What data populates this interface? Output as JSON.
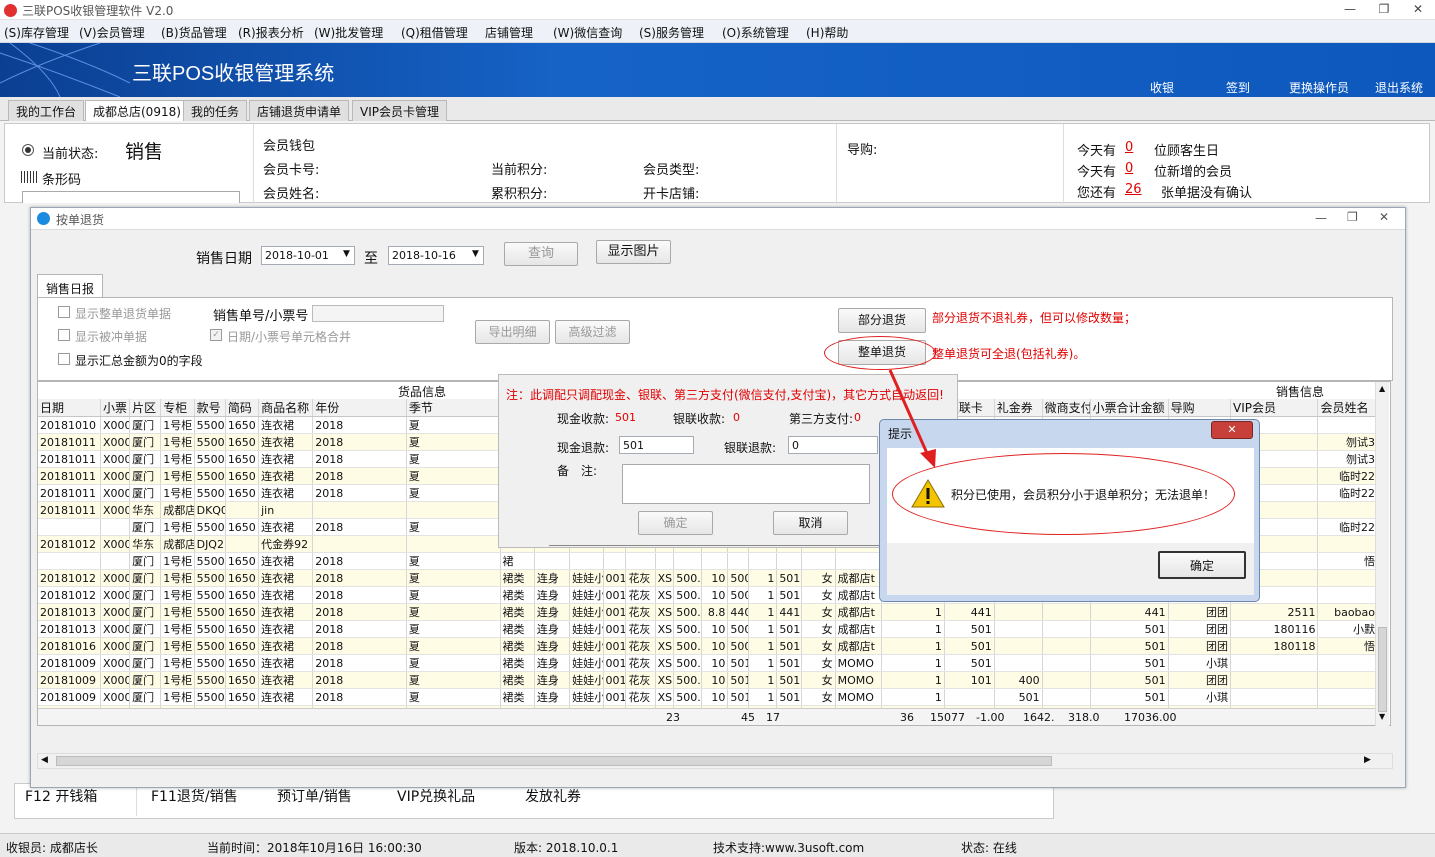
{
  "app": {
    "title": "三联POS收银管理软件 V2.0",
    "brand": "三联POS收银管理系统"
  },
  "window_controls": {
    "minimize": "—",
    "restore": "❐",
    "close": "✕"
  },
  "menu": [
    "(S)库存管理",
    "(V)会员管理",
    "(B)货品管理",
    "(R)报表分析",
    "(W)批发管理",
    "(Q)租借管理",
    "店铺管理",
    "(W)微信查询",
    "(S)服务管理",
    "(O)系统管理",
    "(H)帮助"
  ],
  "banner_links": [
    "收银",
    "签到",
    "更换操作员",
    "退出系统"
  ],
  "tabs": [
    "我的工作台",
    "成都总店(0918)",
    "我的任务",
    "店铺退货申请单",
    "VIP会员卡管理"
  ],
  "status": {
    "label": "当前状态:",
    "value": "销售",
    "barcode": "条形码"
  },
  "member": {
    "wallet": "会员钱包",
    "card_no": "会员卡号:",
    "name": "会员姓名:",
    "points": "当前积分:",
    "acc_points": "累积积分:",
    "type": "会员类型:",
    "store": "开卡店铺:",
    "guide": "导购:"
  },
  "notices": {
    "today1": "今天有",
    "n1": "0",
    "t1": "位顾客生日",
    "today2": "今天有",
    "n2": "0",
    "t2": "位新增的会员",
    "youhave": "您还有",
    "n3": "26",
    "t3": "张单据没有确认"
  },
  "dialog": {
    "title": "按单退货",
    "date_label": "销售日期",
    "date_from": "2018-10-01",
    "date_to_label": "至",
    "date_to": "2018-10-16",
    "query": "查询",
    "show_image": "显示图片",
    "subtab": "销售日报",
    "opt1": "显示整单退货单据",
    "opt2": "显示被冲单据",
    "opt3": "显示汇总金额为0的字段",
    "opt4": "日期/小票号单元格合并",
    "order_label": "销售单号/小票号",
    "export": "导出明细",
    "advanced": "高级过滤",
    "partial": "部分退货",
    "partial_note": "部分退货不退礼券，但可以修改数量；",
    "whole": "整单退货",
    "whole_note": "整单退货可全退(包括礼券)。"
  },
  "grid": {
    "group_left": "货品信息",
    "group_right": "销售信息",
    "headers": [
      "日期",
      "小票",
      "片区",
      "专柜",
      "款号",
      "简码",
      "商品名称",
      "年份",
      "季节",
      "大"
    ],
    "headers_right": [
      "银联卡",
      "礼金券",
      "微商支付",
      "小票合计金额",
      "导购",
      "VIP会员",
      "会员姓名"
    ],
    "rows": [
      [
        "20181010",
        "X000",
        "厦门",
        "1号柜",
        "5500(",
        "1650",
        "连衣裙",
        "2018",
        "夏",
        "裙",
        "",
        "",
        "",
        "",
        "",
        "",
        "",
        "",
        "",
        "",
        "",
        "",
        "",
        "",
        "",
        "",
        "",
        "",
        "",
        ""
      ],
      [
        "20181011",
        "X000",
        "厦门",
        "1号柜",
        "5500(",
        "1650",
        "连衣裙",
        "2018",
        "夏",
        "裙",
        "",
        "",
        "",
        "",
        "",
        "",
        "",
        "",
        "",
        "",
        "",
        "",
        "",
        "",
        "",
        "",
        "013",
        "",
        "",
        "刎试3"
      ],
      [
        "20181011",
        "X000",
        "厦门",
        "1号柜",
        "5500(",
        "1650",
        "连衣裙",
        "2018",
        "夏",
        "裙",
        "",
        "",
        "",
        "",
        "",
        "",
        "",
        "",
        "",
        "",
        "",
        "",
        "",
        "",
        "",
        "",
        "013",
        "",
        "",
        "刎试3"
      ],
      [
        "20181011",
        "X000",
        "厦门",
        "1号柜",
        "5500(",
        "1650",
        "连衣裙",
        "2018",
        "夏",
        "裙",
        "",
        "",
        "",
        "",
        "",
        "",
        "",
        "",
        "",
        "",
        "",
        "",
        "",
        "",
        "",
        "",
        "017",
        "",
        "",
        "临时22"
      ],
      [
        "20181011",
        "X000",
        "厦门",
        "1号柜",
        "5500(",
        "1650",
        "连衣裙",
        "2018",
        "夏",
        "裙",
        "",
        "",
        "",
        "",
        "",
        "",
        "",
        "",
        "",
        "",
        "",
        "",
        "",
        "",
        "",
        "",
        "017",
        "",
        "",
        "临时22"
      ],
      [
        "20181011",
        "X000",
        "华东",
        "成都店",
        "DKQ0(",
        "",
        "jin",
        "",
        "",
        "",
        "",
        "",
        "",
        "",
        "",
        "",
        "",
        "",
        "",
        "",
        "",
        "",
        "",
        "",
        "",
        "",
        "",
        "",
        "",
        ""
      ],
      [
        "",
        "",
        "厦门",
        "1号柜",
        "5500(",
        "1650",
        "连衣裙",
        "2018",
        "夏",
        "裙",
        "",
        "",
        "",
        "",
        "",
        "",
        "",
        "",
        "",
        "",
        "",
        "",
        "",
        "",
        "",
        "",
        "017",
        "",
        "",
        "临时22"
      ],
      [
        "20181012",
        "X000",
        "华东",
        "成都店",
        "DJQ2(",
        "",
        "代金券92",
        "",
        "",
        "",
        "",
        "",
        "",
        "",
        "",
        "",
        "",
        "",
        "",
        "",
        "",
        "",
        "",
        "",
        "",
        "",
        "",
        "",
        "",
        ""
      ],
      [
        "",
        "",
        "厦门",
        "1号柜",
        "5500(",
        "1650",
        "连衣裙",
        "2018",
        "夏",
        "裙",
        "",
        "",
        "",
        "",
        "",
        "",
        "",
        "",
        "",
        "",
        "",
        "",
        "",
        "",
        "",
        "",
        "118",
        "",
        "",
        "悟"
      ],
      [
        "20181012",
        "X000",
        "厦门",
        "1号柜",
        "5500(",
        "1650",
        "连衣裙",
        "2018",
        "夏",
        "裙类",
        "连身",
        "娃娃小",
        "001",
        "花灰",
        "XS",
        "500.",
        "10",
        "500",
        "1",
        "501",
        "女",
        "成都店t",
        "",
        "",
        "",
        "",
        "",
        "",
        "",
        ""
      ],
      [
        "20181012",
        "X000",
        "厦门",
        "1号柜",
        "5500(",
        "1650",
        "连衣裙",
        "2018",
        "夏",
        "裙类",
        "连身",
        "娃娃小",
        "001",
        "花灰",
        "XS",
        "500.",
        "10",
        "500",
        "1",
        "501",
        "女",
        "成都店t",
        "",
        "",
        "",
        "",
        "",
        "",
        "",
        ""
      ],
      [
        "20181013",
        "X000",
        "厦门",
        "1号柜",
        "5500(",
        "1650",
        "连衣裙",
        "2018",
        "夏",
        "裙类",
        "连身",
        "娃娃小",
        "001",
        "花灰",
        "XS",
        "500.",
        "8.8",
        "440",
        "1",
        "441",
        "女",
        "成都店t",
        "1",
        "441",
        "",
        "",
        "441",
        "团团",
        "2511",
        "baobao"
      ],
      [
        "20181013",
        "X000",
        "厦门",
        "1号柜",
        "5500(",
        "1650",
        "连衣裙",
        "2018",
        "夏",
        "裙类",
        "连身",
        "娃娃小",
        "001",
        "花灰",
        "XS",
        "500.",
        "10",
        "500",
        "1",
        "501",
        "女",
        "成都店t",
        "1",
        "501",
        "",
        "",
        "501",
        "团团",
        "180116",
        "小默"
      ],
      [
        "20181016",
        "X000",
        "厦门",
        "1号柜",
        "5500(",
        "1650",
        "连衣裙",
        "2018",
        "夏",
        "裙类",
        "连身",
        "娃娃小",
        "001",
        "花灰",
        "XS",
        "500.",
        "10",
        "500",
        "1",
        "501",
        "女",
        "成都店t",
        "1",
        "501",
        "",
        "",
        "501",
        "团团",
        "180118",
        "悟"
      ],
      [
        "20181009",
        "X000",
        "厦门",
        "1号柜",
        "5500(",
        "1650",
        "连衣裙",
        "2018",
        "夏",
        "裙类",
        "连身",
        "娃娃小",
        "001",
        "花灰",
        "XS",
        "500.",
        "10",
        "501",
        "1",
        "501",
        "女",
        "MOMO",
        "1",
        "501",
        "",
        "",
        "501",
        "小琪",
        "",
        ""
      ],
      [
        "20181009",
        "X000",
        "厦门",
        "1号柜",
        "5500(",
        "1650",
        "连衣裙",
        "2018",
        "夏",
        "裙类",
        "连身",
        "娃娃小",
        "001",
        "花灰",
        "XS",
        "500.",
        "10",
        "501",
        "1",
        "501",
        "女",
        "MOMO",
        "1",
        "101",
        "400",
        "",
        "501",
        "团团",
        "",
        ""
      ],
      [
        "20181009",
        "X000",
        "厦门",
        "1号柜",
        "5500(",
        "1650",
        "连衣裙",
        "2018",
        "夏",
        "裙类",
        "连身",
        "娃娃小",
        "001",
        "花灰",
        "XS",
        "500.",
        "10",
        "501",
        "1",
        "501",
        "女",
        "MOMO",
        "1",
        "",
        "501",
        "",
        "501",
        "小琪",
        "",
        ""
      ],
      [
        "20181011",
        "X000",
        "厦门",
        "1号柜",
        "5500(",
        "1650",
        "连衣裙",
        "2018",
        "夏",
        "裙类",
        "连身",
        "娃娃小",
        "001",
        "花灰",
        "XS",
        "500.",
        "10",
        "501",
        "1",
        "501",
        "女",
        "管理员",
        "1",
        "501",
        "",
        "",
        "501",
        "小琪",
        "",
        ""
      ]
    ],
    "totals": [
      "23",
      "45",
      "17",
      "36",
      "15077",
      "-1.00",
      "1642.",
      "318.0",
      "17036.00"
    ]
  },
  "refund": {
    "note": "注：此调配只调配现金、银联、第三方支付(微信支付,支付宝)，其它方式自动返回!",
    "cash_recv_label": "现金收款:",
    "cash_recv": "501",
    "union_recv_label": "银联收款:",
    "union_recv": "0",
    "third_label": "第三方支付:",
    "third": "0",
    "cash_refund_label": "现金退款:",
    "cash_refund": "501",
    "union_refund_label": "银联退款:",
    "union_refund": "0",
    "remark_label": "备　注:",
    "ok": "确定",
    "cancel": "取消"
  },
  "alert": {
    "title": "提示",
    "message": "积分已使用，会员积分小于退单积分；无法退单！",
    "ok": "确定",
    "close": "✕"
  },
  "bottom_buttons": [
    "F12 开钱箱",
    "F11退货/销售",
    "预订单/销售",
    "VIP兑换礼品",
    "发放礼券"
  ],
  "footer": {
    "cashier": "收银员: 成都店长",
    "time": "当前时间：2018年10月16日 16:00:30",
    "version": "版本: 2018.10.0.1",
    "support": "技术支持:www.3usoft.com",
    "state": "状态: 在线"
  }
}
